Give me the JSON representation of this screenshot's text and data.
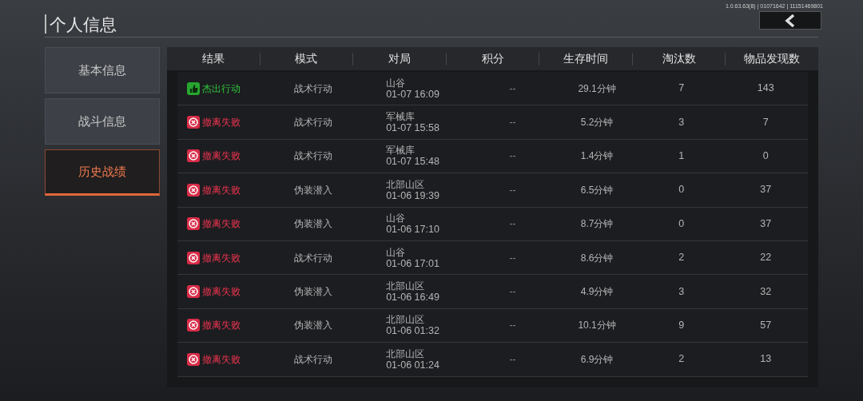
{
  "version": "1.0.63.63(8) | 01071642 | 11151469801",
  "title": "个人信息",
  "sidebar": {
    "items": [
      {
        "label": "基本信息",
        "selected": false
      },
      {
        "label": "战斗信息",
        "selected": false
      },
      {
        "label": "历史战绩",
        "selected": true
      }
    ]
  },
  "table": {
    "columns": [
      "结果",
      "模式",
      "对局",
      "积分",
      "生存时间",
      "淘汰数",
      "物品发现数"
    ],
    "rows": [
      {
        "result": {
          "kind": "success",
          "label": "杰出行动"
        },
        "mode": "战术行动",
        "map": "山谷",
        "time": "01-07 16:09",
        "score": "--",
        "survival": "29.1分钟",
        "kills": "7",
        "items": "143"
      },
      {
        "result": {
          "kind": "fail",
          "label": "撤离失败"
        },
        "mode": "战术行动",
        "map": "军械库",
        "time": "01-07 15:58",
        "score": "--",
        "survival": "5.2分钟",
        "kills": "3",
        "items": "7"
      },
      {
        "result": {
          "kind": "fail",
          "label": "撤离失败"
        },
        "mode": "战术行动",
        "map": "军械库",
        "time": "01-07 15:48",
        "score": "--",
        "survival": "1.4分钟",
        "kills": "1",
        "items": "0"
      },
      {
        "result": {
          "kind": "fail",
          "label": "撤离失败"
        },
        "mode": "伪装潜入",
        "map": "北部山区",
        "time": "01-06 19:39",
        "score": "--",
        "survival": "6.5分钟",
        "kills": "0",
        "items": "37"
      },
      {
        "result": {
          "kind": "fail",
          "label": "撤离失败"
        },
        "mode": "伪装潜入",
        "map": "山谷",
        "time": "01-06 17:10",
        "score": "--",
        "survival": "8.7分钟",
        "kills": "0",
        "items": "37"
      },
      {
        "result": {
          "kind": "fail",
          "label": "撤离失败"
        },
        "mode": "战术行动",
        "map": "山谷",
        "time": "01-06 17:01",
        "score": "--",
        "survival": "8.6分钟",
        "kills": "2",
        "items": "22"
      },
      {
        "result": {
          "kind": "fail",
          "label": "撤离失败"
        },
        "mode": "伪装潜入",
        "map": "北部山区",
        "time": "01-06 16:49",
        "score": "--",
        "survival": "4.9分钟",
        "kills": "3",
        "items": "32"
      },
      {
        "result": {
          "kind": "fail",
          "label": "撤离失败"
        },
        "mode": "伪装潜入",
        "map": "北部山区",
        "time": "01-06 01:32",
        "score": "--",
        "survival": "10.1分钟",
        "kills": "9",
        "items": "57"
      },
      {
        "result": {
          "kind": "fail",
          "label": "撤离失败"
        },
        "mode": "战术行动",
        "map": "北部山区",
        "time": "01-06 01:24",
        "score": "--",
        "survival": "6.9分钟",
        "kills": "2",
        "items": "13"
      }
    ]
  }
}
